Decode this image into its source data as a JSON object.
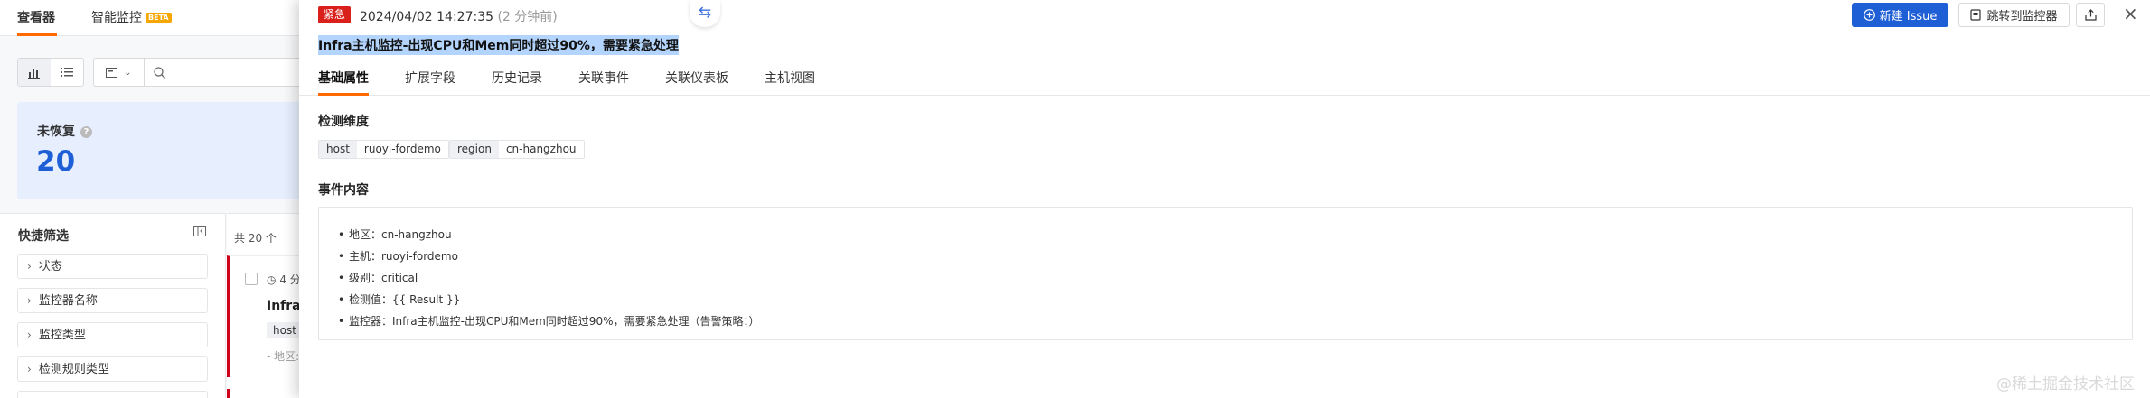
{
  "background": {
    "tabs": [
      {
        "label": "查看器",
        "active": true
      },
      {
        "label": "智能监控",
        "badge": "BETA"
      }
    ],
    "unrecovered": {
      "label": "未恢复",
      "help": "?",
      "count": "20"
    },
    "quick_filter": {
      "title": "快捷筛选",
      "items": [
        "状态",
        "监控器名称",
        "监控类型",
        "检测规则类型"
      ]
    },
    "list": {
      "count_text": "共 20 个",
      "card": {
        "time": "4 分",
        "title": "Infra主",
        "tag": "host",
        "sub": "- 地区:"
      }
    }
  },
  "drawer": {
    "severity": "紧急",
    "time": "2024/04/02 14:27:35",
    "time_ago": "(2 分钟前)",
    "title": "Infra主机监控-出现CPU和Mem同时超过90%，需要紧急处理",
    "actions": {
      "new_issue": "新建 Issue",
      "jump_monitor": "跳转到监控器"
    },
    "tabs": [
      "基础属性",
      "扩展字段",
      "历史记录",
      "关联事件",
      "关联仪表板",
      "主机视图"
    ],
    "active_tab": "基础属性",
    "dimensions_title": "检测维度",
    "dimensions": [
      {
        "key": "host",
        "value": "ruoyi-fordemo"
      },
      {
        "key": "region",
        "value": "cn-hangzhou"
      }
    ],
    "content_title": "事件内容",
    "content_items": [
      "地区：cn-hangzhou",
      "主机：ruoyi-fordemo",
      "级别：critical",
      "检测值：{{ Result }}",
      "监控器：Infra主机监控-出现CPU和Mem同时超过90%，需要紧急处理（告警策略：）"
    ]
  },
  "watermark": "@稀土掘金技术社区",
  "colors": {
    "accent": "#ff6a00",
    "primary": "#1f5fd6",
    "critical": "#d9201b",
    "selection": "#b3d4fc"
  }
}
